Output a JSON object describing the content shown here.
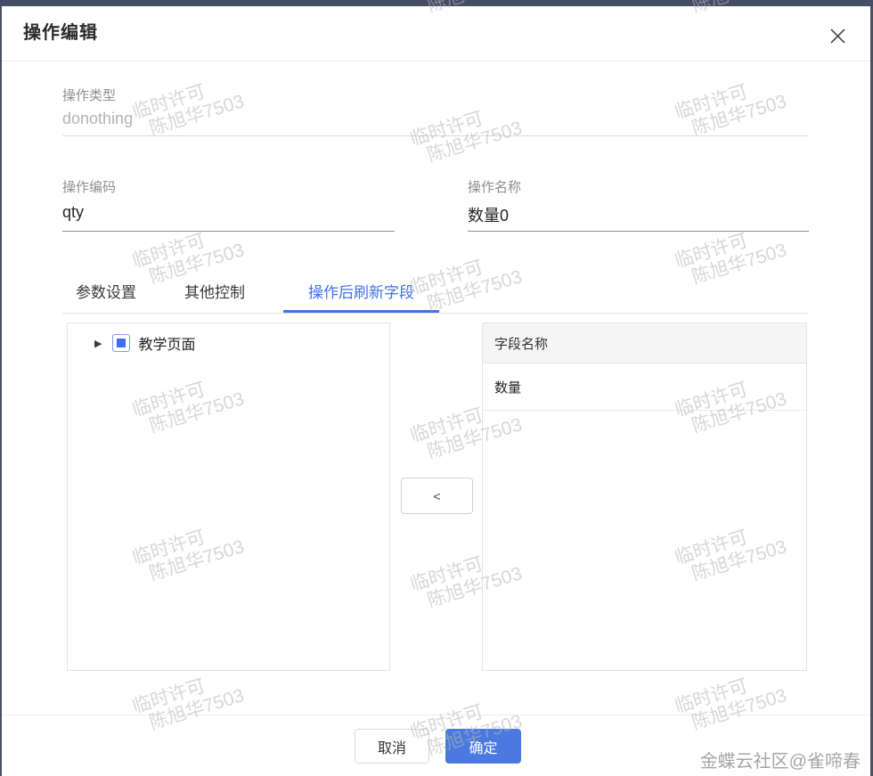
{
  "page": {
    "credit": "金蝶云社区@雀啼春",
    "watermark": {
      "line1": "临时许可",
      "line2": "陈旭华7503"
    }
  },
  "dialog": {
    "title": "操作编辑",
    "close_icon": "✕",
    "fields": {
      "type": {
        "label": "操作类型",
        "value": "donothing",
        "disabled": true
      },
      "code": {
        "label": "操作编码",
        "value": "qty"
      },
      "name": {
        "label": "操作名称",
        "value": "数量0"
      }
    },
    "tabs": [
      {
        "label": "参数设置",
        "active": false
      },
      {
        "label": "其他控制",
        "active": false
      },
      {
        "label": "操作后刷新字段",
        "active": true
      }
    ],
    "tree": {
      "root_label": "教学页面",
      "collapse_arrow": "▶"
    },
    "transfer": {
      "move_left_label": "<"
    },
    "table": {
      "header": "字段名称",
      "rows": [
        "数量"
      ]
    },
    "footer": {
      "cancel_label": "取消",
      "ok_label": "确定"
    },
    "colors": {
      "accent": "#3f72ec",
      "ok_button": "#4a79e0",
      "checkbox": "#3f6ff1",
      "topbar": "#454d66",
      "table_header_bg": "#f5f5f5"
    }
  }
}
